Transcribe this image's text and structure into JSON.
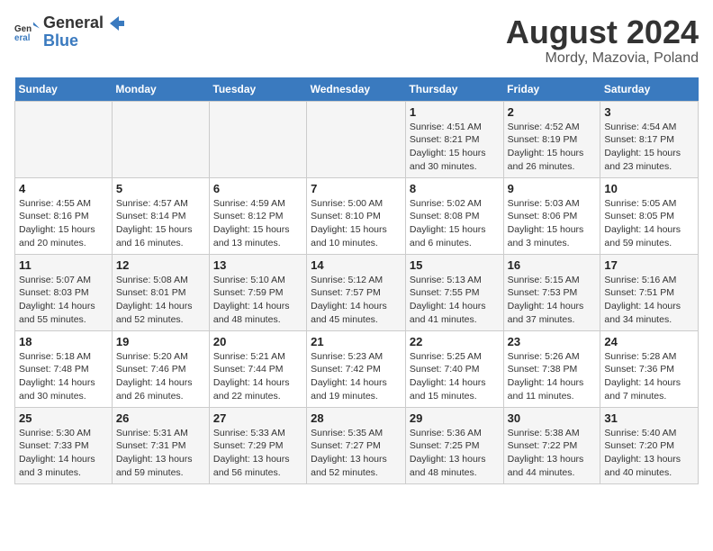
{
  "header": {
    "logo_general": "General",
    "logo_blue": "Blue",
    "title": "August 2024",
    "subtitle": "Mordy, Mazovia, Poland"
  },
  "days_of_week": [
    "Sunday",
    "Monday",
    "Tuesday",
    "Wednesday",
    "Thursday",
    "Friday",
    "Saturday"
  ],
  "weeks": [
    [
      {
        "day": "",
        "info": ""
      },
      {
        "day": "",
        "info": ""
      },
      {
        "day": "",
        "info": ""
      },
      {
        "day": "",
        "info": ""
      },
      {
        "day": "1",
        "info": "Sunrise: 4:51 AM\nSunset: 8:21 PM\nDaylight: 15 hours\nand 30 minutes."
      },
      {
        "day": "2",
        "info": "Sunrise: 4:52 AM\nSunset: 8:19 PM\nDaylight: 15 hours\nand 26 minutes."
      },
      {
        "day": "3",
        "info": "Sunrise: 4:54 AM\nSunset: 8:17 PM\nDaylight: 15 hours\nand 23 minutes."
      }
    ],
    [
      {
        "day": "4",
        "info": "Sunrise: 4:55 AM\nSunset: 8:16 PM\nDaylight: 15 hours\nand 20 minutes."
      },
      {
        "day": "5",
        "info": "Sunrise: 4:57 AM\nSunset: 8:14 PM\nDaylight: 15 hours\nand 16 minutes."
      },
      {
        "day": "6",
        "info": "Sunrise: 4:59 AM\nSunset: 8:12 PM\nDaylight: 15 hours\nand 13 minutes."
      },
      {
        "day": "7",
        "info": "Sunrise: 5:00 AM\nSunset: 8:10 PM\nDaylight: 15 hours\nand 10 minutes."
      },
      {
        "day": "8",
        "info": "Sunrise: 5:02 AM\nSunset: 8:08 PM\nDaylight: 15 hours\nand 6 minutes."
      },
      {
        "day": "9",
        "info": "Sunrise: 5:03 AM\nSunset: 8:06 PM\nDaylight: 15 hours\nand 3 minutes."
      },
      {
        "day": "10",
        "info": "Sunrise: 5:05 AM\nSunset: 8:05 PM\nDaylight: 14 hours\nand 59 minutes."
      }
    ],
    [
      {
        "day": "11",
        "info": "Sunrise: 5:07 AM\nSunset: 8:03 PM\nDaylight: 14 hours\nand 55 minutes."
      },
      {
        "day": "12",
        "info": "Sunrise: 5:08 AM\nSunset: 8:01 PM\nDaylight: 14 hours\nand 52 minutes."
      },
      {
        "day": "13",
        "info": "Sunrise: 5:10 AM\nSunset: 7:59 PM\nDaylight: 14 hours\nand 48 minutes."
      },
      {
        "day": "14",
        "info": "Sunrise: 5:12 AM\nSunset: 7:57 PM\nDaylight: 14 hours\nand 45 minutes."
      },
      {
        "day": "15",
        "info": "Sunrise: 5:13 AM\nSunset: 7:55 PM\nDaylight: 14 hours\nand 41 minutes."
      },
      {
        "day": "16",
        "info": "Sunrise: 5:15 AM\nSunset: 7:53 PM\nDaylight: 14 hours\nand 37 minutes."
      },
      {
        "day": "17",
        "info": "Sunrise: 5:16 AM\nSunset: 7:51 PM\nDaylight: 14 hours\nand 34 minutes."
      }
    ],
    [
      {
        "day": "18",
        "info": "Sunrise: 5:18 AM\nSunset: 7:48 PM\nDaylight: 14 hours\nand 30 minutes."
      },
      {
        "day": "19",
        "info": "Sunrise: 5:20 AM\nSunset: 7:46 PM\nDaylight: 14 hours\nand 26 minutes."
      },
      {
        "day": "20",
        "info": "Sunrise: 5:21 AM\nSunset: 7:44 PM\nDaylight: 14 hours\nand 22 minutes."
      },
      {
        "day": "21",
        "info": "Sunrise: 5:23 AM\nSunset: 7:42 PM\nDaylight: 14 hours\nand 19 minutes."
      },
      {
        "day": "22",
        "info": "Sunrise: 5:25 AM\nSunset: 7:40 PM\nDaylight: 14 hours\nand 15 minutes."
      },
      {
        "day": "23",
        "info": "Sunrise: 5:26 AM\nSunset: 7:38 PM\nDaylight: 14 hours\nand 11 minutes."
      },
      {
        "day": "24",
        "info": "Sunrise: 5:28 AM\nSunset: 7:36 PM\nDaylight: 14 hours\nand 7 minutes."
      }
    ],
    [
      {
        "day": "25",
        "info": "Sunrise: 5:30 AM\nSunset: 7:33 PM\nDaylight: 14 hours\nand 3 minutes."
      },
      {
        "day": "26",
        "info": "Sunrise: 5:31 AM\nSunset: 7:31 PM\nDaylight: 13 hours\nand 59 minutes."
      },
      {
        "day": "27",
        "info": "Sunrise: 5:33 AM\nSunset: 7:29 PM\nDaylight: 13 hours\nand 56 minutes."
      },
      {
        "day": "28",
        "info": "Sunrise: 5:35 AM\nSunset: 7:27 PM\nDaylight: 13 hours\nand 52 minutes."
      },
      {
        "day": "29",
        "info": "Sunrise: 5:36 AM\nSunset: 7:25 PM\nDaylight: 13 hours\nand 48 minutes."
      },
      {
        "day": "30",
        "info": "Sunrise: 5:38 AM\nSunset: 7:22 PM\nDaylight: 13 hours\nand 44 minutes."
      },
      {
        "day": "31",
        "info": "Sunrise: 5:40 AM\nSunset: 7:20 PM\nDaylight: 13 hours\nand 40 minutes."
      }
    ]
  ]
}
